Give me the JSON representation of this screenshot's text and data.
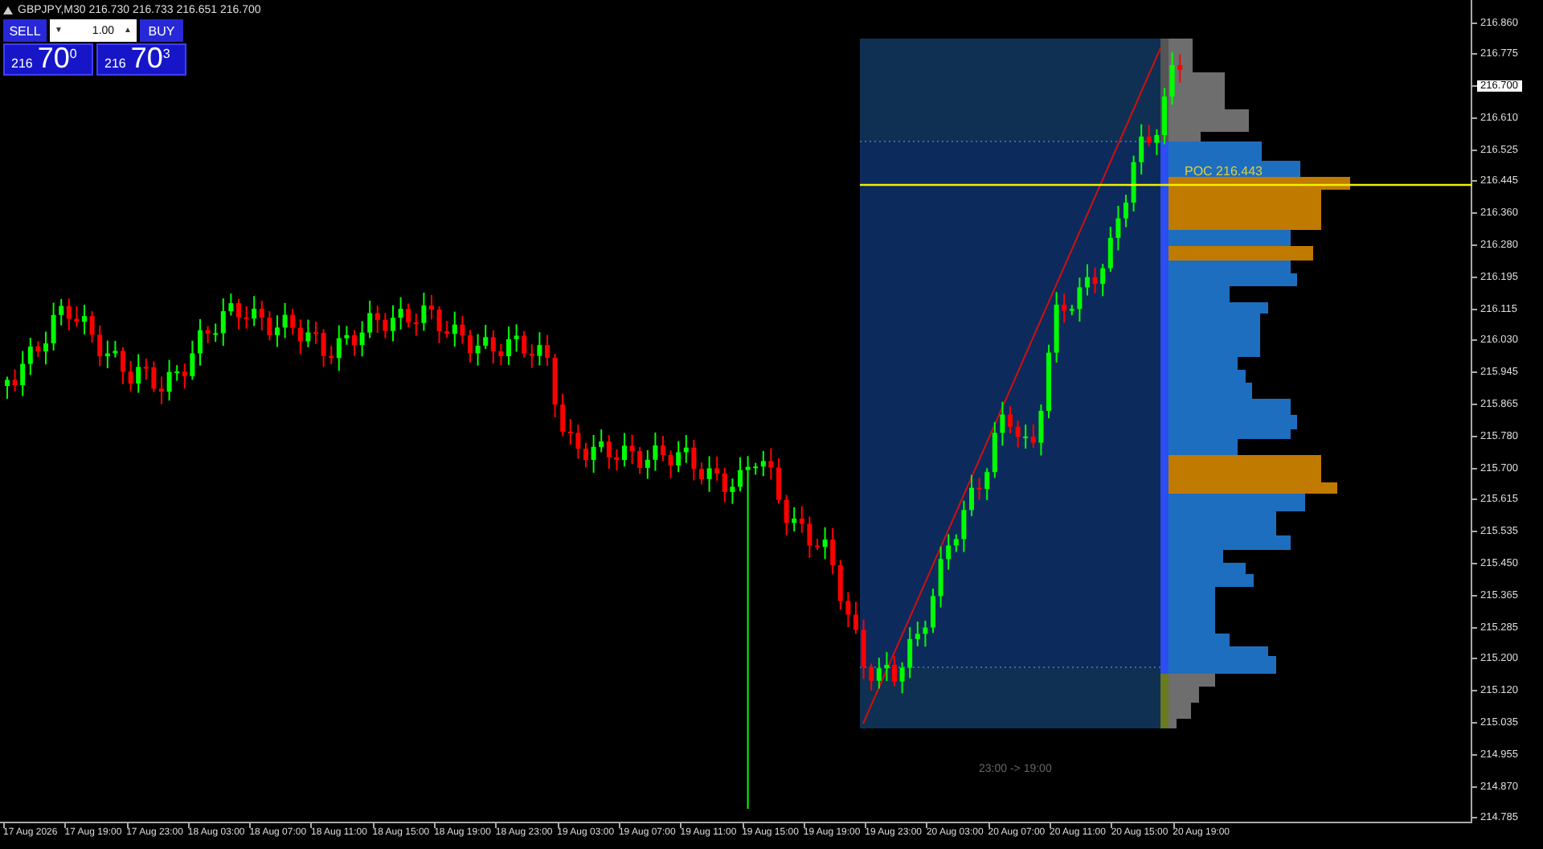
{
  "symbol_bar": {
    "title": "GBPJPY,M30  216.730 216.733 216.651 216.700"
  },
  "one_click": {
    "sell_label": "SELL",
    "buy_label": "BUY",
    "volume": "1.00",
    "down_arrow": "▼",
    "up_arrow": "▲",
    "sell_price": {
      "lead": "216",
      "main": "70",
      "sup": "0"
    },
    "buy_price": {
      "lead": "216",
      "main": "70",
      "sup": "3"
    }
  },
  "volume_profile": {
    "poc_label": "POC 216.443",
    "session_label": "23:00 -> 19:00"
  },
  "price_axis": [
    {
      "text": "216.860",
      "current": false
    },
    {
      "text": "216.775",
      "current": false
    },
    {
      "text": "216.700",
      "current": true
    },
    {
      "text": "216.610",
      "current": false
    },
    {
      "text": "216.525",
      "current": false
    },
    {
      "text": "216.445",
      "current": false
    },
    {
      "text": "216.360",
      "current": false
    },
    {
      "text": "216.280",
      "current": false
    },
    {
      "text": "216.195",
      "current": false
    },
    {
      "text": "216.115",
      "current": false
    },
    {
      "text": "216.030",
      "current": false
    },
    {
      "text": "215.945",
      "current": false
    },
    {
      "text": "215.865",
      "current": false
    },
    {
      "text": "215.780",
      "current": false
    },
    {
      "text": "215.700",
      "current": false
    },
    {
      "text": "215.615",
      "current": false
    },
    {
      "text": "215.535",
      "current": false
    },
    {
      "text": "215.450",
      "current": false
    },
    {
      "text": "215.365",
      "current": false
    },
    {
      "text": "215.285",
      "current": false
    },
    {
      "text": "215.200",
      "current": false
    },
    {
      "text": "215.120",
      "current": false
    },
    {
      "text": "215.035",
      "current": false
    },
    {
      "text": "214.955",
      "current": false
    },
    {
      "text": "214.870",
      "current": false
    },
    {
      "text": "214.785",
      "current": false
    }
  ],
  "time_axis": [
    "17 Aug 2026",
    "17 Aug 19:00",
    "17 Aug 23:00",
    "18 Aug 03:00",
    "18 Aug 07:00",
    "18 Aug 11:00",
    "18 Aug 15:00",
    "18 Aug 19:00",
    "18 Aug 23:00",
    "19 Aug 03:00",
    "19 Aug 07:00",
    "19 Aug 11:00",
    "19 Aug 15:00",
    "19 Aug 19:00",
    "19 Aug 23:00",
    "20 Aug 03:00",
    "20 Aug 07:00",
    "20 Aug 11:00",
    "20 Aug 15:00",
    "20 Aug 19:00"
  ]
}
